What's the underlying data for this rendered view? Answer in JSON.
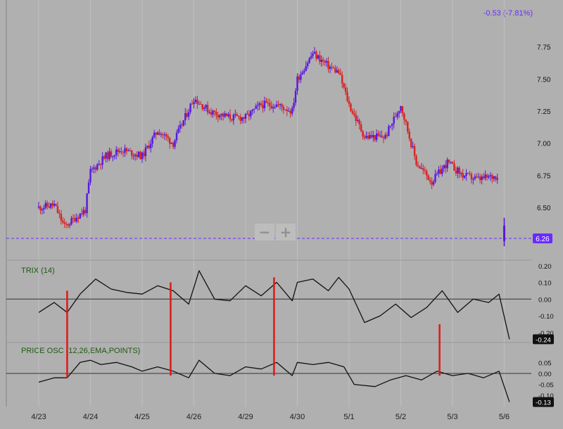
{
  "header": {
    "change_text": "-0.53 (-7.81%)"
  },
  "colors": {
    "background": "#b0b0b0",
    "up_candle": "#5a18e0",
    "down_candle": "#d92222",
    "accent": "#6a2bff",
    "line": "#111111",
    "marker": "#e01818",
    "label_green": "#1e5a12"
  },
  "zoom": {
    "minus_label": "−",
    "plus_label": "+"
  },
  "chart_data": [
    {
      "type": "candlestick",
      "title": "",
      "x_tick_labels": [
        "4/23",
        "4/24",
        "4/25",
        "4/26",
        "4/29",
        "4/30",
        "5/1",
        "5/2",
        "5/3",
        "5/6"
      ],
      "y_tick_labels": [
        "6.50",
        "6.75",
        "7.00",
        "7.25",
        "7.50",
        "7.75"
      ],
      "ylim": [
        6.2,
        7.95
      ],
      "last_price_label": "6.26",
      "last_price": 6.26,
      "grid": true,
      "price_path": [
        {
          "x": 0.0,
          "y": 6.5
        },
        {
          "x": 0.3,
          "y": 6.52
        },
        {
          "x": 0.5,
          "y": 6.35
        },
        {
          "x": 0.7,
          "y": 6.42
        },
        {
          "x": 0.9,
          "y": 6.48
        },
        {
          "x": 1.0,
          "y": 6.78
        },
        {
          "x": 1.3,
          "y": 6.9
        },
        {
          "x": 1.6,
          "y": 6.95
        },
        {
          "x": 2.0,
          "y": 6.9
        },
        {
          "x": 2.3,
          "y": 7.1
        },
        {
          "x": 2.6,
          "y": 7.0
        },
        {
          "x": 3.0,
          "y": 7.35
        },
        {
          "x": 3.3,
          "y": 7.25
        },
        {
          "x": 3.7,
          "y": 7.2
        },
        {
          "x": 4.0,
          "y": 7.2
        },
        {
          "x": 4.3,
          "y": 7.3
        },
        {
          "x": 4.6,
          "y": 7.3
        },
        {
          "x": 4.9,
          "y": 7.25
        },
        {
          "x": 5.0,
          "y": 7.5
        },
        {
          "x": 5.3,
          "y": 7.7
        },
        {
          "x": 5.6,
          "y": 7.6
        },
        {
          "x": 5.8,
          "y": 7.55
        },
        {
          "x": 6.0,
          "y": 7.3
        },
        {
          "x": 6.3,
          "y": 7.05
        },
        {
          "x": 6.7,
          "y": 7.05
        },
        {
          "x": 7.0,
          "y": 7.3
        },
        {
          "x": 7.3,
          "y": 6.85
        },
        {
          "x": 7.6,
          "y": 6.7
        },
        {
          "x": 7.9,
          "y": 6.85
        },
        {
          "x": 8.2,
          "y": 6.75
        },
        {
          "x": 8.5,
          "y": 6.72
        },
        {
          "x": 8.9,
          "y": 6.75
        }
      ]
    },
    {
      "type": "line",
      "title": "TRIX (14)",
      "y_tick_labels": [
        "0.20",
        "0.10",
        "0.00",
        "-0.10",
        "-0.20"
      ],
      "ylim": [
        -0.23,
        0.22
      ],
      "last_value_label": "-0.24",
      "grid": true,
      "series": [
        {
          "x": [
            0.0,
            0.3,
            0.55,
            0.8,
            1.1,
            1.4,
            1.7,
            2.0,
            2.3,
            2.6,
            2.9,
            3.1,
            3.4,
            3.7,
            4.0,
            4.3,
            4.6,
            4.9,
            5.0,
            5.3,
            5.6,
            5.8,
            6.0,
            6.3,
            6.6,
            6.9,
            7.2,
            7.5,
            7.8,
            8.1,
            8.4,
            8.7,
            8.9,
            9.1
          ],
          "values": [
            -0.08,
            -0.02,
            -0.08,
            0.03,
            0.12,
            0.06,
            0.04,
            0.03,
            0.08,
            0.05,
            -0.03,
            0.17,
            0.0,
            -0.01,
            0.08,
            0.02,
            0.1,
            -0.01,
            0.1,
            0.12,
            0.05,
            0.13,
            0.06,
            -0.14,
            -0.1,
            -0.03,
            -0.11,
            -0.05,
            0.05,
            -0.08,
            0.0,
            -0.02,
            0.03,
            -0.24
          ]
        }
      ]
    },
    {
      "type": "line",
      "title": "PRICE OSC (12,26,EMA,POINTS)",
      "y_tick_labels": [
        "0.05",
        "0.00",
        "-0.05",
        "-0.10"
      ],
      "ylim": [
        -0.125,
        0.115
      ],
      "last_value_label": "-0.13",
      "grid": true,
      "series": [
        {
          "x": [
            0.0,
            0.3,
            0.55,
            0.8,
            1.0,
            1.2,
            1.5,
            1.8,
            2.0,
            2.3,
            2.6,
            2.9,
            3.1,
            3.4,
            3.7,
            4.0,
            4.3,
            4.6,
            4.9,
            5.0,
            5.3,
            5.6,
            5.9,
            6.1,
            6.5,
            6.8,
            7.1,
            7.4,
            7.7,
            8.0,
            8.3,
            8.6,
            8.9,
            9.1
          ],
          "values": [
            -0.04,
            -0.02,
            -0.02,
            0.05,
            0.06,
            0.04,
            0.05,
            0.03,
            0.01,
            0.03,
            0.01,
            -0.02,
            0.06,
            0.0,
            -0.01,
            0.03,
            0.02,
            0.05,
            -0.01,
            0.05,
            0.04,
            0.05,
            0.03,
            -0.05,
            -0.06,
            -0.03,
            -0.01,
            -0.03,
            0.01,
            -0.01,
            0.0,
            -0.02,
            0.01,
            -0.13
          ]
        }
      ]
    }
  ],
  "markers": [
    {
      "x": 0.55,
      "top": 0.05,
      "bottom": -0.02
    },
    {
      "x": 2.55,
      "top": 0.1,
      "bottom": -0.01
    },
    {
      "x": 4.55,
      "top": 0.13,
      "bottom": -0.01
    },
    {
      "x": 7.75,
      "top": -0.15,
      "bottom": -0.01
    }
  ]
}
